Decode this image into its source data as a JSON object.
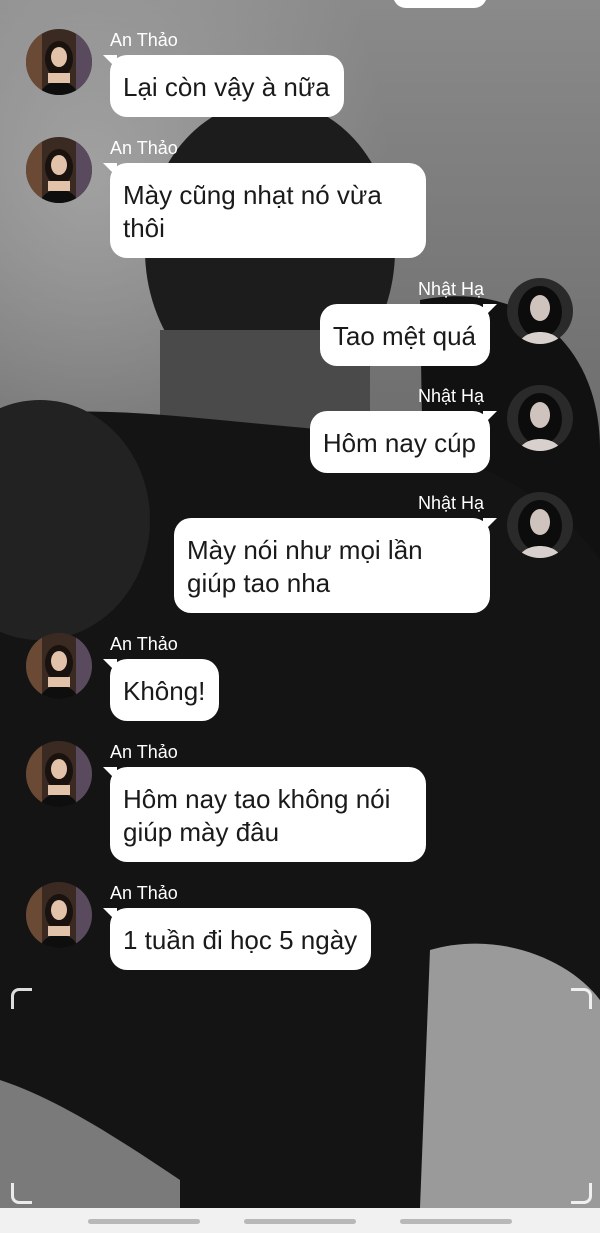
{
  "colors": {
    "bubble": "#ffffff",
    "bubble_text": "#1a1a1a",
    "sender_text": "#ffffff",
    "navbar": "#f1f1f1"
  },
  "messages": [
    {
      "sender": "An Thảo",
      "text": "Lại còn vậy à nữa",
      "side": "left"
    },
    {
      "sender": "An Thảo",
      "text": "Mày cũng nhạt nó vừa thôi",
      "side": "left"
    },
    {
      "sender": "Nhật Hạ",
      "text": "Tao mệt quá",
      "side": "right"
    },
    {
      "sender": "Nhật Hạ",
      "text": "Hôm nay cúp",
      "side": "right"
    },
    {
      "sender": "Nhật Hạ",
      "text": "Mày nói như mọi lần giúp tao nha",
      "side": "right"
    },
    {
      "sender": "An Thảo",
      "text": "Không!",
      "side": "left"
    },
    {
      "sender": "An Thảo",
      "text": "Hôm nay tao không nói giúp mày đâu",
      "side": "left"
    },
    {
      "sender": "An Thảo",
      "text": "1 tuần đi học 5 ngày",
      "side": "left"
    }
  ],
  "icons": {
    "viewfinder": "corner-bracket-icon",
    "nav_recent": "recent-apps-icon",
    "nav_home": "home-icon",
    "nav_back": "back-icon"
  }
}
